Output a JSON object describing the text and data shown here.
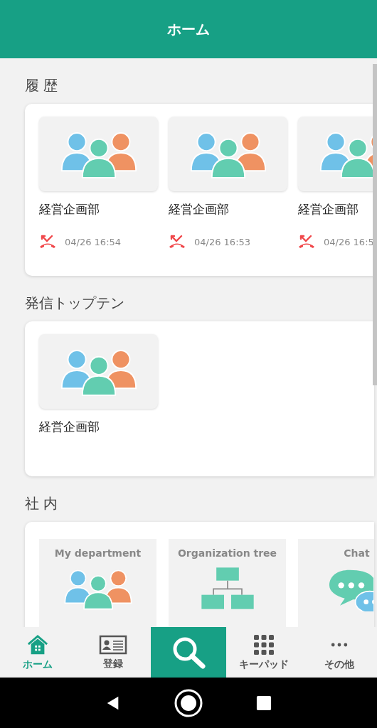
{
  "header": {
    "title": "ホーム"
  },
  "sections": [
    {
      "title": "履 歴",
      "kind": "history",
      "items": [
        {
          "name": "経営企画部",
          "time": "04/26 16:54"
        },
        {
          "name": "経営企画部",
          "time": "04/26 16:53"
        },
        {
          "name": "経営企画部",
          "time": "04/26 16:5"
        }
      ]
    },
    {
      "title": "発信トップテン",
      "kind": "top",
      "items": [
        {
          "name": "経営企画部"
        }
      ]
    },
    {
      "title": "社 内",
      "kind": "menu",
      "items": [
        {
          "label": "My department",
          "kind": "group"
        },
        {
          "label": "Organization tree",
          "kind": "tree"
        },
        {
          "label": "Chat",
          "kind": "chat"
        }
      ]
    }
  ],
  "bottom_nav": [
    {
      "kind": "home",
      "label": "ホーム",
      "selected": true
    },
    {
      "kind": "card",
      "label": "登録",
      "selected": false
    },
    {
      "kind": "search"
    },
    {
      "kind": "keypad",
      "label": "キーパッド",
      "selected": false
    },
    {
      "kind": "more",
      "label": "その他",
      "selected": false
    }
  ]
}
